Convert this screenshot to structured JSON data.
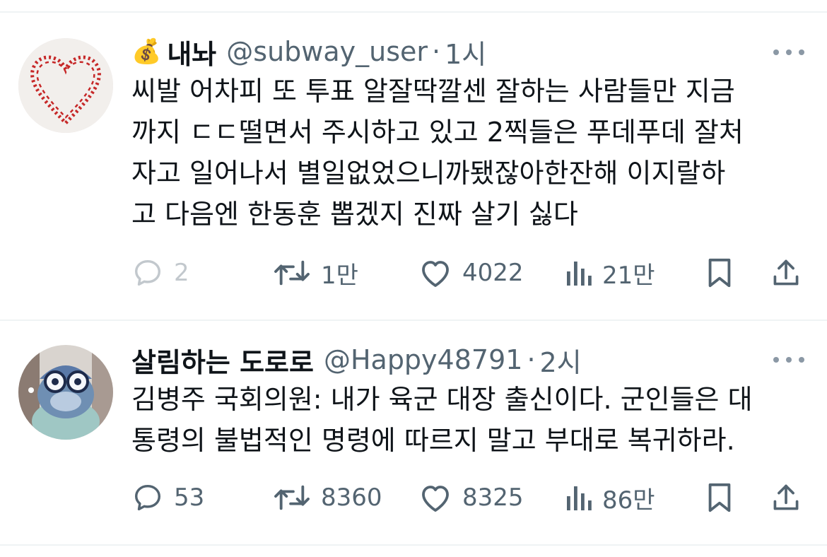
{
  "tweets": [
    {
      "emoji": "💰",
      "display_name": "내놔",
      "handle": "@subway_user",
      "separator": "·",
      "time": "1시",
      "avatar_icon": "baseball-heart",
      "text_lines": [
        "씨발 어차피 또 투표 알잘딱깔센 잘하는 사람들만 지금",
        "까지 ㄷㄷ떨면서 주시하고 있고 2찍들은 푸데푸데 잘처",
        "자고 일어나서 별일없었으니까됐잖아한잔해 이지랄하",
        "고 다음엔 한동훈 뽑겠지 진짜 살기 싫다"
      ],
      "replies": "2",
      "retweets": "1만",
      "likes": "4022",
      "views": "21만"
    },
    {
      "display_name": "살림하는 도로로",
      "handle": "@Happy48791",
      "separator": "·",
      "time": "2시",
      "avatar_icon": "blue-frog-character",
      "text_lines": [
        "김병주 국회의원: 내가 육군 대장 출신이다. 군인들은 대",
        "통령의 불법적인 명령에 따르지 말고 부대로 복귀하라."
      ],
      "replies": "53",
      "retweets": "8360",
      "likes": "8325",
      "views": "86만"
    }
  ],
  "icons": {
    "reply": "speech-bubble-icon",
    "retweet": "retweet-arrows-icon",
    "like": "heart-outline-icon",
    "views": "bar-chart-icon",
    "bookmark": "bookmark-icon",
    "share": "upload-share-icon",
    "more": "ellipsis-icon"
  },
  "colors": {
    "text": "#0f1419",
    "secondary": "#536471",
    "divider": "#eff3f4",
    "baseball_stitch": "#c62828"
  }
}
